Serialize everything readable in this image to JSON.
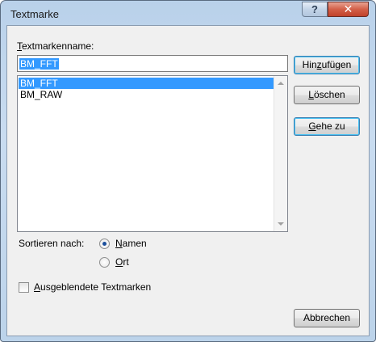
{
  "window": {
    "title": "Textmarke",
    "help_glyph": "?",
    "close_glyph": "✕"
  },
  "bookmark_name": {
    "label_mnemonic": "T",
    "label_rest": "extmarkenname:",
    "value": "BM_FFT"
  },
  "bookmark_list": {
    "items": [
      {
        "label": "BM_FFT",
        "selected": true
      },
      {
        "label": "BM_RAW",
        "selected": false
      }
    ]
  },
  "buttons": {
    "add_pre": "Hin",
    "add_mnemonic": "z",
    "add_post": "ufügen",
    "delete_mnemonic": "L",
    "delete_rest": "öschen",
    "goto_mnemonic": "G",
    "goto_rest": "ehe zu",
    "cancel": "Abbrechen"
  },
  "sort": {
    "label": "Sortieren nach:",
    "name_mnemonic": "N",
    "name_rest": "amen",
    "location_mnemonic": "O",
    "location_rest": "rt",
    "selected": "Namen"
  },
  "hidden_bookmarks": {
    "mnemonic": "A",
    "rest": "usgeblendete Textmarken",
    "checked": false
  }
}
